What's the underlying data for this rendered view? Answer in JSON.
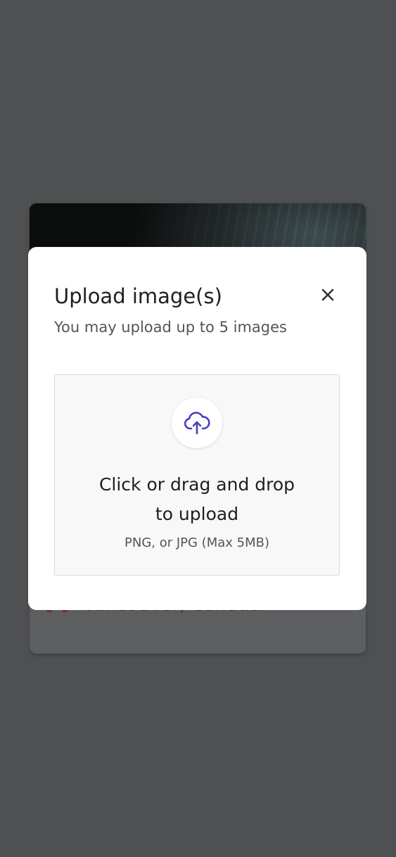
{
  "background_page": {
    "location_text": "Vancouver, Canada"
  },
  "modal": {
    "title": "Upload image(s)",
    "subtitle": "You may upload up to 5 images",
    "close_icon": "close-icon",
    "dropzone": {
      "icon": "cloud-upload-icon",
      "title_line1": "Click or drag and drop",
      "title_line2": "to upload",
      "hint": "PNG, or JPG (Max 5MB)"
    }
  },
  "colors": {
    "accent": "#4a3fc1",
    "backdrop": "#4f5052",
    "modal_bg": "#ffffff",
    "dropzone_bg": "#f8f8f8"
  }
}
